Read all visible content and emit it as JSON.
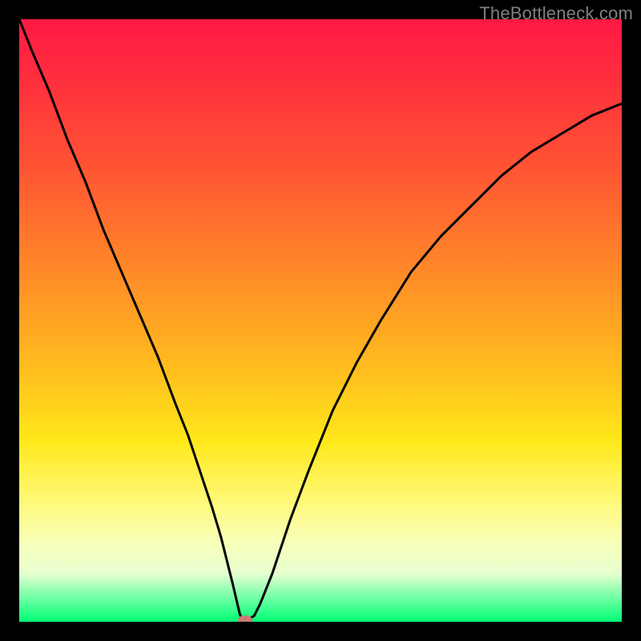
{
  "watermark": "TheBottleneck.com",
  "chart_data": {
    "type": "line",
    "title": "",
    "xlabel": "",
    "ylabel": "",
    "xlim": [
      0,
      100
    ],
    "ylim": [
      0,
      100
    ],
    "series": [
      {
        "name": "curve",
        "x": [
          0,
          2,
          5,
          8,
          11,
          14,
          17,
          20,
          23,
          26,
          28,
          30,
          32,
          33.5,
          34.5,
          35.5,
          36.2,
          36.6,
          37,
          37.4,
          38,
          39,
          40,
          42,
          45,
          48,
          52,
          56,
          60,
          65,
          70,
          75,
          80,
          85,
          90,
          95,
          100
        ],
        "y": [
          100,
          95,
          88,
          80,
          73,
          65,
          58,
          51,
          44,
          36,
          31,
          25,
          19,
          14,
          10,
          6,
          3,
          1.3,
          0.4,
          0.4,
          0.4,
          1,
          3,
          8,
          17,
          25,
          35,
          43,
          50,
          58,
          64,
          69,
          74,
          78,
          81,
          84,
          86
        ]
      }
    ],
    "marker": {
      "x": 37.5,
      "y": 0.3
    }
  }
}
